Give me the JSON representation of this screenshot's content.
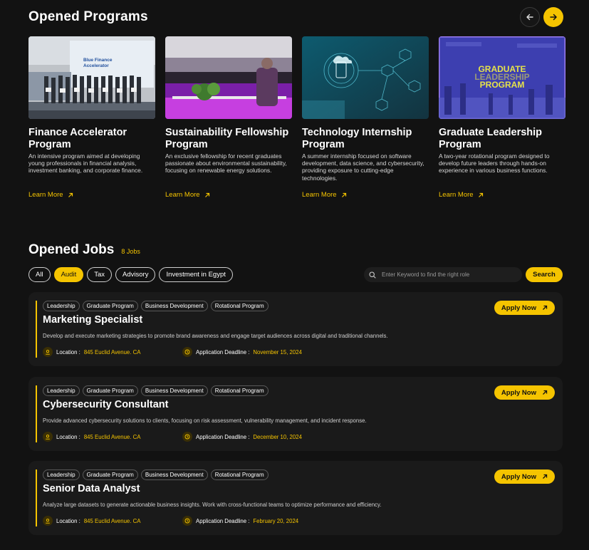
{
  "programs": {
    "title": "Opened Programs",
    "nav": {
      "prev_icon": "arrow-left-icon",
      "next_icon": "arrow-right-icon"
    },
    "items": [
      {
        "title": "Finance Accelerator Program",
        "description": "An intensive program aimed at developing young professionals in financial analysis, investment banking, and corporate finance.",
        "link": "Learn More",
        "image_banner_line1": "Blue Finance",
        "image_banner_line2": "Accelerator"
      },
      {
        "title": "Sustainability Fellowship Program",
        "description": "An exclusive fellowship for recent graduates passionate about environmental sustainability, focusing on renewable energy solutions.",
        "link": "Learn More"
      },
      {
        "title": "Technology Internship Program",
        "description": "A summer internship focused on software development, data science, and cybersecurity, providing exposure to cutting-edge technologies.",
        "link": "Learn More"
      },
      {
        "title": "Graduate Leadership Program",
        "description": "A two-year rotational program designed to develop future leaders through hands-on experience in various business functions.",
        "link": "Learn More",
        "image_text": [
          "GRADUATE",
          "LEADERSHIP",
          "PROGRAM"
        ]
      }
    ]
  },
  "jobs": {
    "title": "Opened Jobs",
    "count": "8 Jobs",
    "filters": [
      "All",
      "Audit",
      "Tax",
      "Advisory",
      "Investment in Egypt"
    ],
    "active_filter": "Audit",
    "search": {
      "placeholder": "Enter Keyword to find the right role",
      "button": "Search"
    },
    "apply_label": "Apply Now",
    "location_label": "Location :",
    "deadline_label": "Application Deadline :",
    "items": [
      {
        "tags": [
          "Leadership",
          "Graduate Program",
          "Business Development",
          "Rotational Program"
        ],
        "title": "Marketing Specialist",
        "description": "Develop and execute marketing strategies to promote brand awareness and engage target audiences across digital and traditional channels.",
        "location": "845 Euclid Avenue. CA",
        "deadline": "November 15, 2024"
      },
      {
        "tags": [
          "Leadership",
          "Graduate Program",
          "Business Development",
          "Rotational Program"
        ],
        "title": "Cybersecurity Consultant",
        "description": "Provide advanced cybersecurity solutions to clients, focusing on risk assessment, vulnerability management, and incident response.",
        "location": "845 Euclid Avenue. CA",
        "deadline": "December 10, 2024"
      },
      {
        "tags": [
          "Leadership",
          "Graduate Program",
          "Business Development",
          "Rotational Program"
        ],
        "title": "Senior Data Analyst",
        "description": "Analyze large datasets to generate actionable business insights. Work with cross-functional teams to optimize performance and efficiency.",
        "location": "845 Euclid Avenue. CA",
        "deadline": "February 20, 2024"
      }
    ]
  },
  "colors": {
    "accent": "#f5c400",
    "background": "#121212",
    "card": "#1a1a1a"
  }
}
